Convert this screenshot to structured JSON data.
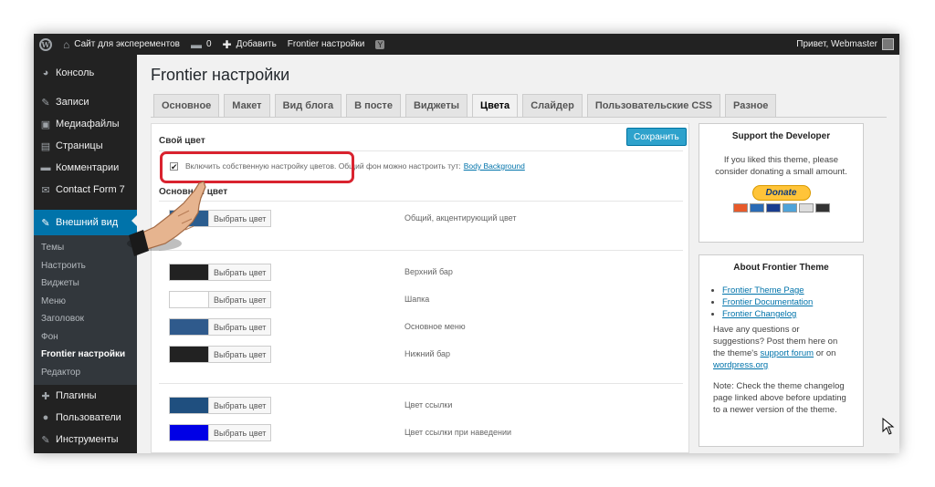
{
  "admin_bar": {
    "site_name": "Сайт для эксперементов",
    "comments_count": "0",
    "add_label": "Добавить",
    "frontier_label": "Frontier настройки",
    "greeting": "Привет, Webmaster"
  },
  "sidebar": {
    "items": [
      {
        "icon": "dashboard-icon",
        "glyph": "◕",
        "label": "Консоль"
      },
      {
        "icon": "pin-icon",
        "glyph": "✎",
        "label": "Записи"
      },
      {
        "icon": "media-icon",
        "glyph": "▣",
        "label": "Медиафайлы"
      },
      {
        "icon": "pages-icon",
        "glyph": "▤",
        "label": "Страницы"
      },
      {
        "icon": "comments-icon",
        "glyph": "▬",
        "label": "Комментарии"
      },
      {
        "icon": "mail-icon",
        "glyph": "✉",
        "label": "Contact Form 7"
      },
      {
        "icon": "appearance-icon",
        "glyph": "✎",
        "label": "Внешний вид"
      }
    ],
    "submenu": [
      "Темы",
      "Настроить",
      "Виджеты",
      "Меню",
      "Заголовок",
      "Фон",
      "Frontier настройки",
      "Редактор"
    ],
    "bottom_items": [
      {
        "icon": "plugins-icon",
        "glyph": "✚",
        "label": "Плагины"
      },
      {
        "icon": "users-icon",
        "glyph": "●",
        "label": "Пользователи"
      },
      {
        "icon": "tools-icon",
        "glyph": "✎",
        "label": "Инструменты"
      }
    ]
  },
  "page": {
    "title": "Frontier настройки",
    "tabs": [
      "Основное",
      "Макет",
      "Вид блога",
      "В посте",
      "Виджеты",
      "Цвета",
      "Слайдер",
      "Пользовательские CSS",
      "Разное"
    ],
    "active_tab": "Цвета"
  },
  "panel": {
    "section_title": "Свой цвет",
    "save_label": "Сохранить",
    "checkbox_checked": true,
    "checkbox_text": "Включить собственную настройку цветов. Общий фон можно настроить тут:",
    "checkbox_link": "Body Background",
    "section2_title": "Основной цвет",
    "picker_label": "Выбрать цвет",
    "colors": [
      {
        "label": "Общий, акцентирующий цвет",
        "color": "#2b5d8f"
      },
      {
        "label": "Верхний бар",
        "color": "#222222"
      },
      {
        "label": "Шапка",
        "color": "#ffffff"
      },
      {
        "label": "Основное меню",
        "color": "#2f5a8c"
      },
      {
        "label": "Нижний бар",
        "color": "#222222"
      },
      {
        "label": "Цвет ссылки",
        "color": "#1f4f7f"
      },
      {
        "label": "Цвет ссылки при наведении",
        "color": "#0000e6"
      }
    ]
  },
  "support_widget": {
    "title": "Support the Developer",
    "text": "If you liked this theme, please consider donating a small amount.",
    "donate_label": "Donate"
  },
  "about_widget": {
    "title": "About Frontier Theme",
    "links": [
      "Frontier Theme Page",
      "Frontier Documentation",
      "Frontier Changelog"
    ],
    "questions_text": "Have any questions or suggestions? Post them here on the theme's",
    "support_link": "support forum",
    "or_text": "or on",
    "wp_link": "wordpress.org",
    "note": "Note: Check the theme changelog page linked above before updating to a newer version of the theme."
  },
  "colors": {
    "accent": "#0073aa",
    "highlight": "#d9232f",
    "sidebar_bg": "#222222"
  }
}
